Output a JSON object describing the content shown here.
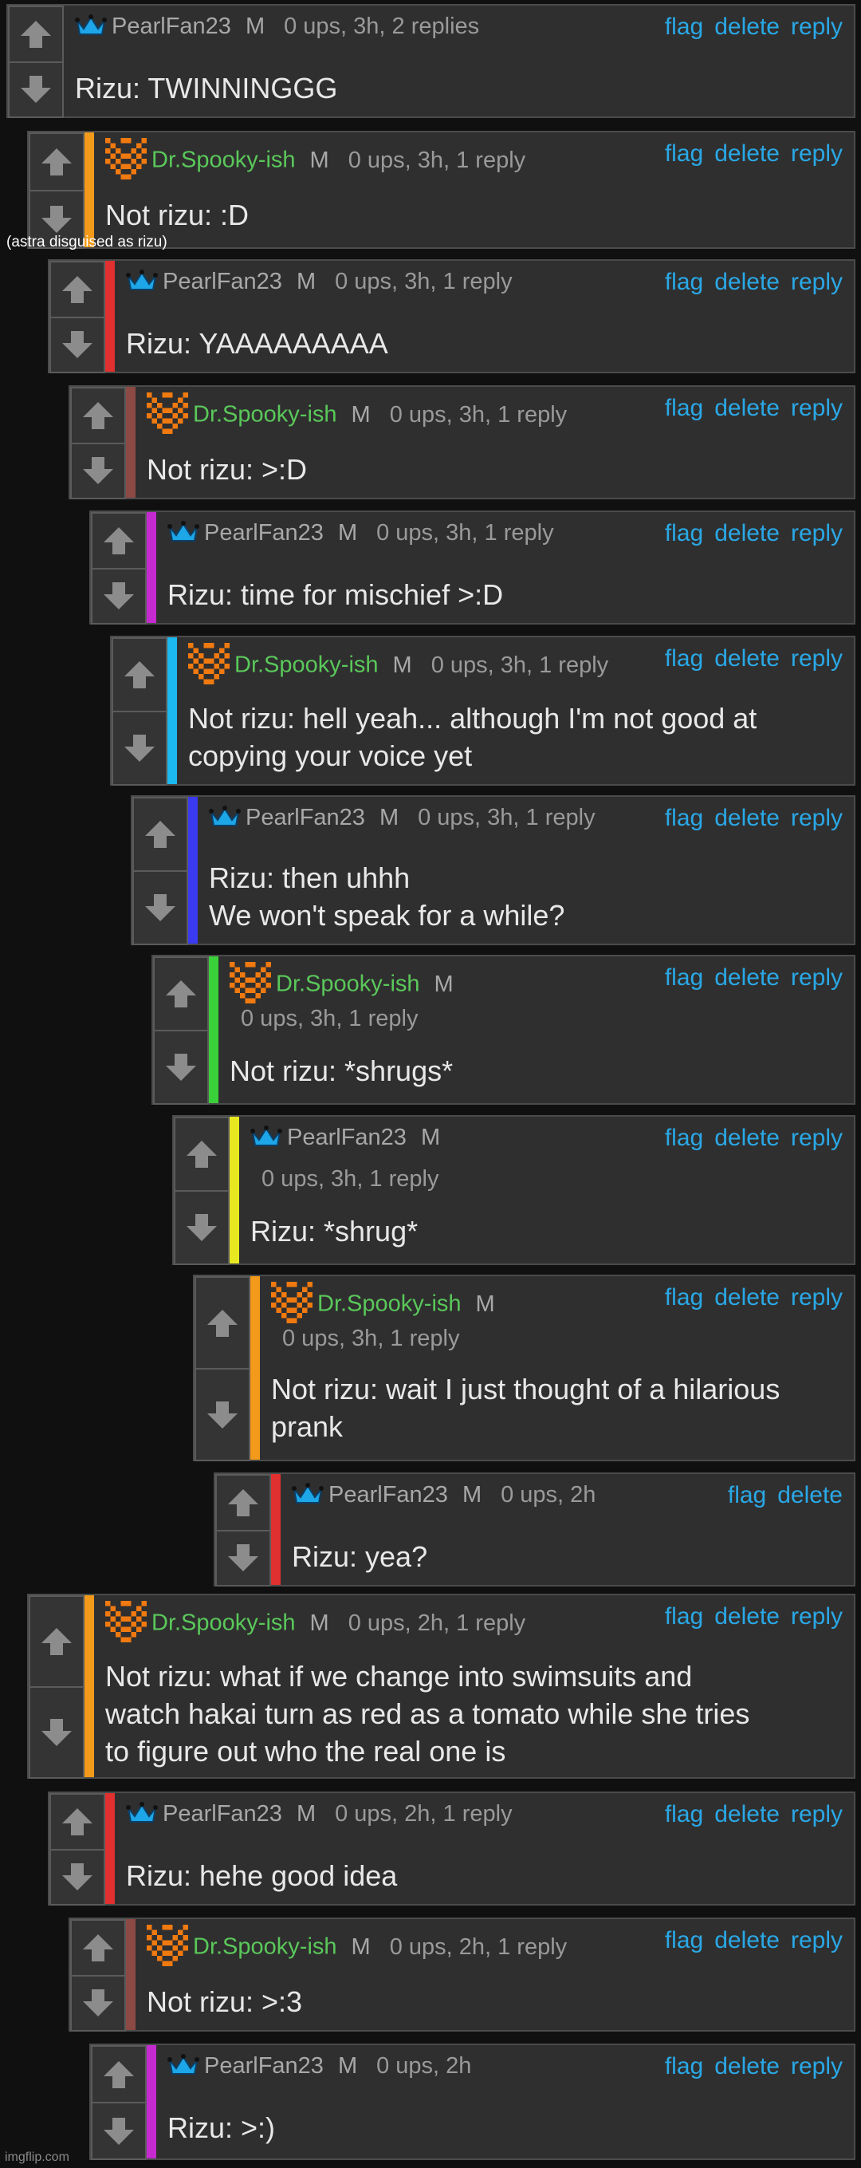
{
  "annotation": "(astra disguised as rizu)",
  "watermark": "imgflip.com",
  "colors": {
    "link": "#2aa8e6",
    "green_user": "#5ac85a"
  },
  "comments": [
    {
      "user": "PearlFan23",
      "badge": "M",
      "meta": "0 ups, 3h, 2 replies",
      "actions": [
        "flag",
        "delete",
        "reply"
      ],
      "text": "Rizu: TWINNINGGG",
      "bar": ""
    },
    {
      "user": "Dr.Spooky-ish",
      "badge": "M",
      "meta": "0 ups, 3h, 1 reply",
      "actions": [
        "flag",
        "delete",
        "reply"
      ],
      "text": "Not rizu: :D",
      "bar": "#f39a1a"
    },
    {
      "user": "PearlFan23",
      "badge": "M",
      "meta": "0 ups, 3h, 1 reply",
      "actions": [
        "flag",
        "delete",
        "reply"
      ],
      "text": "Rizu: YAAAAAAAAA",
      "bar": "#e03030"
    },
    {
      "user": "Dr.Spooky-ish",
      "badge": "M",
      "meta": "0 ups, 3h, 1 reply",
      "actions": [
        "flag",
        "delete",
        "reply"
      ],
      "text": "Not rizu: >:D",
      "bar": "#8b4a44"
    },
    {
      "user": "PearlFan23",
      "badge": "M",
      "meta": "0 ups, 3h, 1 reply",
      "actions": [
        "flag",
        "delete",
        "reply"
      ],
      "text": "Rizu: time for mischief >:D",
      "bar": "#c42ad0"
    },
    {
      "user": "Dr.Spooky-ish",
      "badge": "M",
      "meta": "0 ups, 3h, 1 reply",
      "actions": [
        "flag",
        "delete",
        "reply"
      ],
      "text_lines": [
        "Not rizu: hell yeah... although I'm not good at",
        "copying your voice yet"
      ],
      "bar": "#1cb8f0"
    },
    {
      "user": "PearlFan23",
      "badge": "M",
      "meta": "0 ups, 3h, 1 reply",
      "actions": [
        "flag",
        "delete",
        "reply"
      ],
      "text_lines": [
        "Rizu: then uhhh",
        "We won't speak for a while?"
      ],
      "bar": "#3a3af0"
    },
    {
      "user": "Dr.Spooky-ish",
      "badge": "M",
      "meta": "0 ups, 3h, 1 reply",
      "actions": [
        "flag",
        "delete",
        "reply"
      ],
      "text": "Not rizu: *shrugs*",
      "bar": "#3ad03a"
    },
    {
      "user": "PearlFan23",
      "badge": "M",
      "meta": "0 ups, 3h, 1 reply",
      "actions": [
        "flag",
        "delete",
        "reply"
      ],
      "text": "Rizu: *shrug*",
      "bar": "#e8e820"
    },
    {
      "user": "Dr.Spooky-ish",
      "badge": "M",
      "meta": "0 ups, 3h, 1 reply",
      "actions": [
        "flag",
        "delete",
        "reply"
      ],
      "text_lines": [
        "Not rizu: wait I just thought of a hilarious",
        "prank"
      ],
      "bar": "#f39a1a"
    },
    {
      "user": "PearlFan23",
      "badge": "M",
      "meta": "0 ups, 2h",
      "actions": [
        "flag",
        "delete"
      ],
      "text": "Rizu: yea?",
      "bar": "#e03030"
    },
    {
      "user": "Dr.Spooky-ish",
      "badge": "M",
      "meta": "0 ups, 2h, 1 reply",
      "actions": [
        "flag",
        "delete",
        "reply"
      ],
      "text_lines": [
        "Not rizu: what if we change into swimsuits and",
        "watch hakai turn as red as a tomato while she tries",
        "to figure out who the real one is"
      ],
      "bar": "#f39a1a"
    },
    {
      "user": "PearlFan23",
      "badge": "M",
      "meta": "0 ups, 2h, 1 reply",
      "actions": [
        "flag",
        "delete",
        "reply"
      ],
      "text": "Rizu: hehe good idea",
      "bar": "#e03030"
    },
    {
      "user": "Dr.Spooky-ish",
      "badge": "M",
      "meta": "0 ups, 2h, 1 reply",
      "actions": [
        "flag",
        "delete",
        "reply"
      ],
      "text": "Not rizu: >:3",
      "bar": "#8b4a44"
    },
    {
      "user": "PearlFan23",
      "badge": "M",
      "meta": "0 ups, 2h",
      "actions": [
        "flag",
        "delete",
        "reply"
      ],
      "text": "Rizu: >:)",
      "bar": "#c42ad0"
    }
  ]
}
